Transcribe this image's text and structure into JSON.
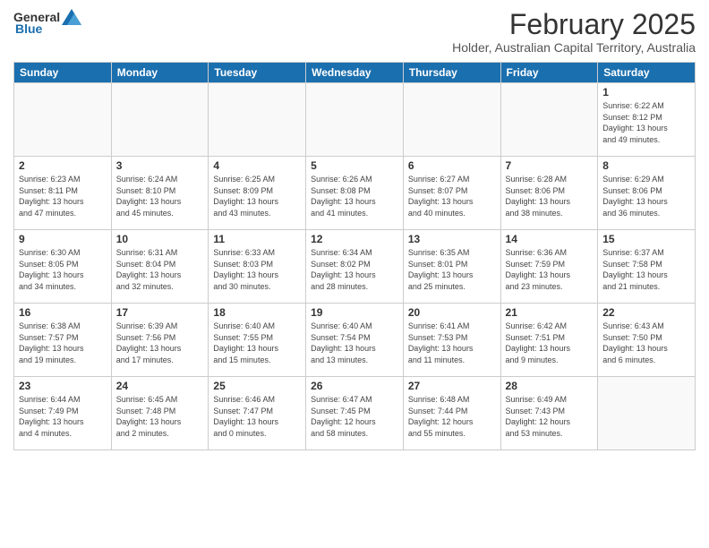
{
  "header": {
    "logo_general": "General",
    "logo_blue": "Blue",
    "title": "February 2025",
    "location": "Holder, Australian Capital Territory, Australia"
  },
  "days_of_week": [
    "Sunday",
    "Monday",
    "Tuesday",
    "Wednesday",
    "Thursday",
    "Friday",
    "Saturday"
  ],
  "weeks": [
    {
      "days": [
        {
          "num": "",
          "info": ""
        },
        {
          "num": "",
          "info": ""
        },
        {
          "num": "",
          "info": ""
        },
        {
          "num": "",
          "info": ""
        },
        {
          "num": "",
          "info": ""
        },
        {
          "num": "",
          "info": ""
        },
        {
          "num": "1",
          "info": "Sunrise: 6:22 AM\nSunset: 8:12 PM\nDaylight: 13 hours\nand 49 minutes."
        }
      ]
    },
    {
      "days": [
        {
          "num": "2",
          "info": "Sunrise: 6:23 AM\nSunset: 8:11 PM\nDaylight: 13 hours\nand 47 minutes."
        },
        {
          "num": "3",
          "info": "Sunrise: 6:24 AM\nSunset: 8:10 PM\nDaylight: 13 hours\nand 45 minutes."
        },
        {
          "num": "4",
          "info": "Sunrise: 6:25 AM\nSunset: 8:09 PM\nDaylight: 13 hours\nand 43 minutes."
        },
        {
          "num": "5",
          "info": "Sunrise: 6:26 AM\nSunset: 8:08 PM\nDaylight: 13 hours\nand 41 minutes."
        },
        {
          "num": "6",
          "info": "Sunrise: 6:27 AM\nSunset: 8:07 PM\nDaylight: 13 hours\nand 40 minutes."
        },
        {
          "num": "7",
          "info": "Sunrise: 6:28 AM\nSunset: 8:06 PM\nDaylight: 13 hours\nand 38 minutes."
        },
        {
          "num": "8",
          "info": "Sunrise: 6:29 AM\nSunset: 8:06 PM\nDaylight: 13 hours\nand 36 minutes."
        }
      ]
    },
    {
      "days": [
        {
          "num": "9",
          "info": "Sunrise: 6:30 AM\nSunset: 8:05 PM\nDaylight: 13 hours\nand 34 minutes."
        },
        {
          "num": "10",
          "info": "Sunrise: 6:31 AM\nSunset: 8:04 PM\nDaylight: 13 hours\nand 32 minutes."
        },
        {
          "num": "11",
          "info": "Sunrise: 6:33 AM\nSunset: 8:03 PM\nDaylight: 13 hours\nand 30 minutes."
        },
        {
          "num": "12",
          "info": "Sunrise: 6:34 AM\nSunset: 8:02 PM\nDaylight: 13 hours\nand 28 minutes."
        },
        {
          "num": "13",
          "info": "Sunrise: 6:35 AM\nSunset: 8:01 PM\nDaylight: 13 hours\nand 25 minutes."
        },
        {
          "num": "14",
          "info": "Sunrise: 6:36 AM\nSunset: 7:59 PM\nDaylight: 13 hours\nand 23 minutes."
        },
        {
          "num": "15",
          "info": "Sunrise: 6:37 AM\nSunset: 7:58 PM\nDaylight: 13 hours\nand 21 minutes."
        }
      ]
    },
    {
      "days": [
        {
          "num": "16",
          "info": "Sunrise: 6:38 AM\nSunset: 7:57 PM\nDaylight: 13 hours\nand 19 minutes."
        },
        {
          "num": "17",
          "info": "Sunrise: 6:39 AM\nSunset: 7:56 PM\nDaylight: 13 hours\nand 17 minutes."
        },
        {
          "num": "18",
          "info": "Sunrise: 6:40 AM\nSunset: 7:55 PM\nDaylight: 13 hours\nand 15 minutes."
        },
        {
          "num": "19",
          "info": "Sunrise: 6:40 AM\nSunset: 7:54 PM\nDaylight: 13 hours\nand 13 minutes."
        },
        {
          "num": "20",
          "info": "Sunrise: 6:41 AM\nSunset: 7:53 PM\nDaylight: 13 hours\nand 11 minutes."
        },
        {
          "num": "21",
          "info": "Sunrise: 6:42 AM\nSunset: 7:51 PM\nDaylight: 13 hours\nand 9 minutes."
        },
        {
          "num": "22",
          "info": "Sunrise: 6:43 AM\nSunset: 7:50 PM\nDaylight: 13 hours\nand 6 minutes."
        }
      ]
    },
    {
      "days": [
        {
          "num": "23",
          "info": "Sunrise: 6:44 AM\nSunset: 7:49 PM\nDaylight: 13 hours\nand 4 minutes."
        },
        {
          "num": "24",
          "info": "Sunrise: 6:45 AM\nSunset: 7:48 PM\nDaylight: 13 hours\nand 2 minutes."
        },
        {
          "num": "25",
          "info": "Sunrise: 6:46 AM\nSunset: 7:47 PM\nDaylight: 13 hours\nand 0 minutes."
        },
        {
          "num": "26",
          "info": "Sunrise: 6:47 AM\nSunset: 7:45 PM\nDaylight: 12 hours\nand 58 minutes."
        },
        {
          "num": "27",
          "info": "Sunrise: 6:48 AM\nSunset: 7:44 PM\nDaylight: 12 hours\nand 55 minutes."
        },
        {
          "num": "28",
          "info": "Sunrise: 6:49 AM\nSunset: 7:43 PM\nDaylight: 12 hours\nand 53 minutes."
        },
        {
          "num": "",
          "info": ""
        }
      ]
    }
  ]
}
